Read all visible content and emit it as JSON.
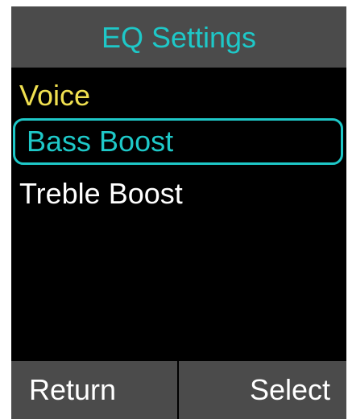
{
  "title": "EQ Settings",
  "menu": {
    "items": [
      {
        "label": "Voice",
        "state": "current"
      },
      {
        "label": "Bass Boost",
        "state": "highlighted"
      },
      {
        "label": "Treble Boost",
        "state": "normal"
      }
    ]
  },
  "softkeys": {
    "left": "Return",
    "right": "Select"
  },
  "colors": {
    "title_text": "#1ec8c8",
    "bar_background": "#4b4b4b",
    "screen_background": "#000000",
    "current_item_text": "#f0e050",
    "highlight": "#1ec8c8",
    "normal_text": "#ffffff"
  }
}
